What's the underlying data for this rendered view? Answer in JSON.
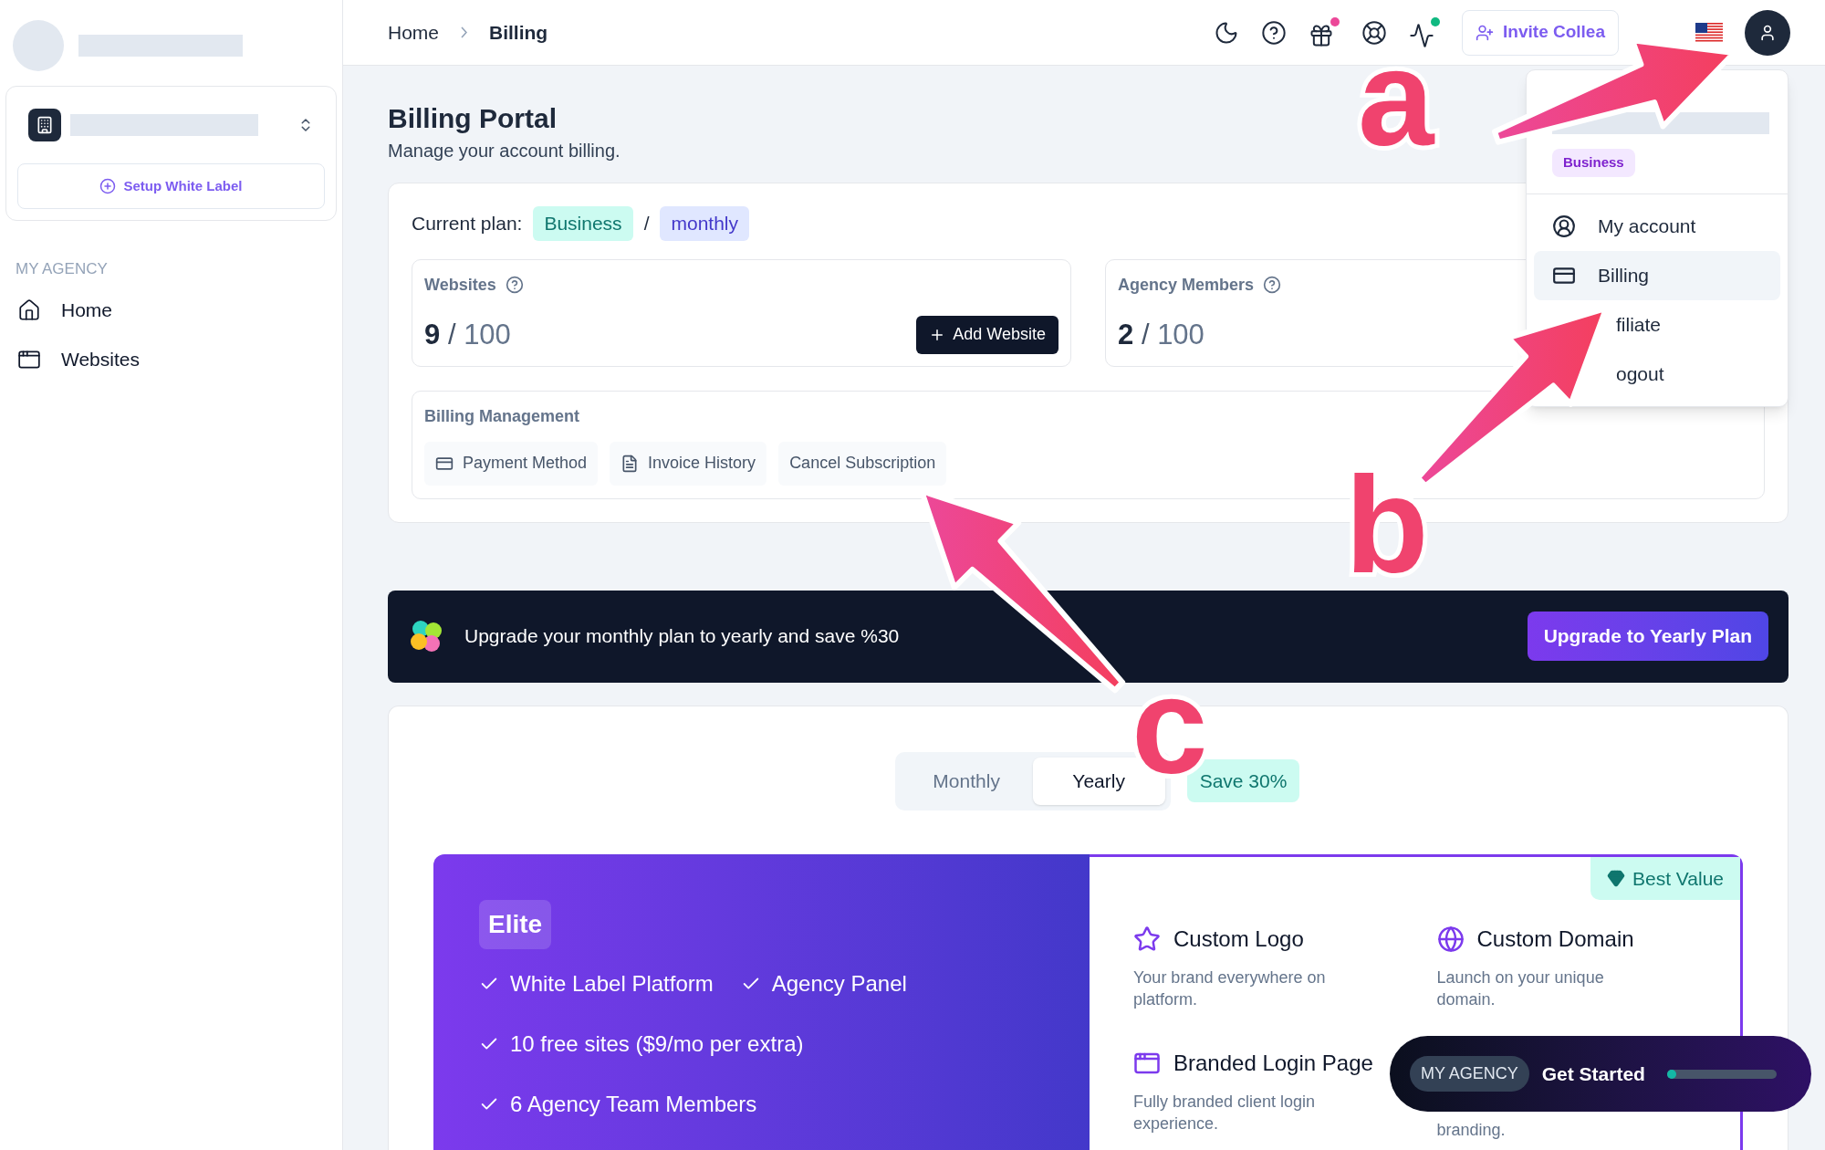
{
  "sidebar": {
    "setup_button": "Setup White Label",
    "section_label": "MY AGENCY",
    "items": [
      {
        "label": "Home"
      },
      {
        "label": "Websites"
      }
    ]
  },
  "breadcrumbs": [
    "Home",
    "Billing"
  ],
  "header": {
    "invite_button": "Invite Collea"
  },
  "user_menu": {
    "badge": "Business",
    "items": [
      {
        "label": "My account",
        "selected": false
      },
      {
        "label": "Billing",
        "selected": true
      },
      {
        "label": "filiate",
        "selected": false
      },
      {
        "label": "ogout",
        "selected": false
      }
    ]
  },
  "page": {
    "title": "Billing Portal",
    "subtitle": "Manage your account billing."
  },
  "plan": {
    "label": "Current plan:",
    "tier": "Business",
    "separator": "/",
    "period": "monthly"
  },
  "usage": [
    {
      "label": "Websites",
      "used": "9",
      "separator": "/",
      "limit": "100",
      "action": "Add Website"
    },
    {
      "label": "Agency Members",
      "used": "2",
      "separator": "/",
      "limit": "100"
    }
  ],
  "billing_management": {
    "title": "Billing Management",
    "actions": [
      "Payment Method",
      "Invoice History",
      "Cancel Subscription"
    ]
  },
  "upgrade_banner": {
    "text": "Upgrade your monthly plan to yearly and save %30",
    "button": "Upgrade to Yearly Plan"
  },
  "billing_toggle": [
    {
      "label": "Monthly",
      "selected": false
    },
    {
      "label": "Yearly",
      "selected": true
    }
  ],
  "save_badge": "Save 30%",
  "elite_plan": {
    "name": "Elite",
    "features": [
      [
        "White Label Platform",
        "Agency Panel"
      ],
      [
        "10 free sites ($9/mo per extra)"
      ],
      [
        "6 Agency Team Members"
      ]
    ],
    "ribbon": "Best Value",
    "perks": [
      {
        "title": "Custom Logo",
        "description": "Your brand everywhere on platform."
      },
      {
        "title": "Custom Domain",
        "description": "Launch on your unique domain."
      },
      {
        "title": "Branded Login Page",
        "description": "Fully branded client login experience."
      },
      {
        "description": "branding."
      }
    ]
  },
  "onboarding": {
    "tag": "MY AGENCY",
    "label": "Get Started",
    "level": 0.08
  },
  "annotations": [
    {
      "label": "a"
    },
    {
      "label": "b"
    },
    {
      "label": "c"
    }
  ]
}
